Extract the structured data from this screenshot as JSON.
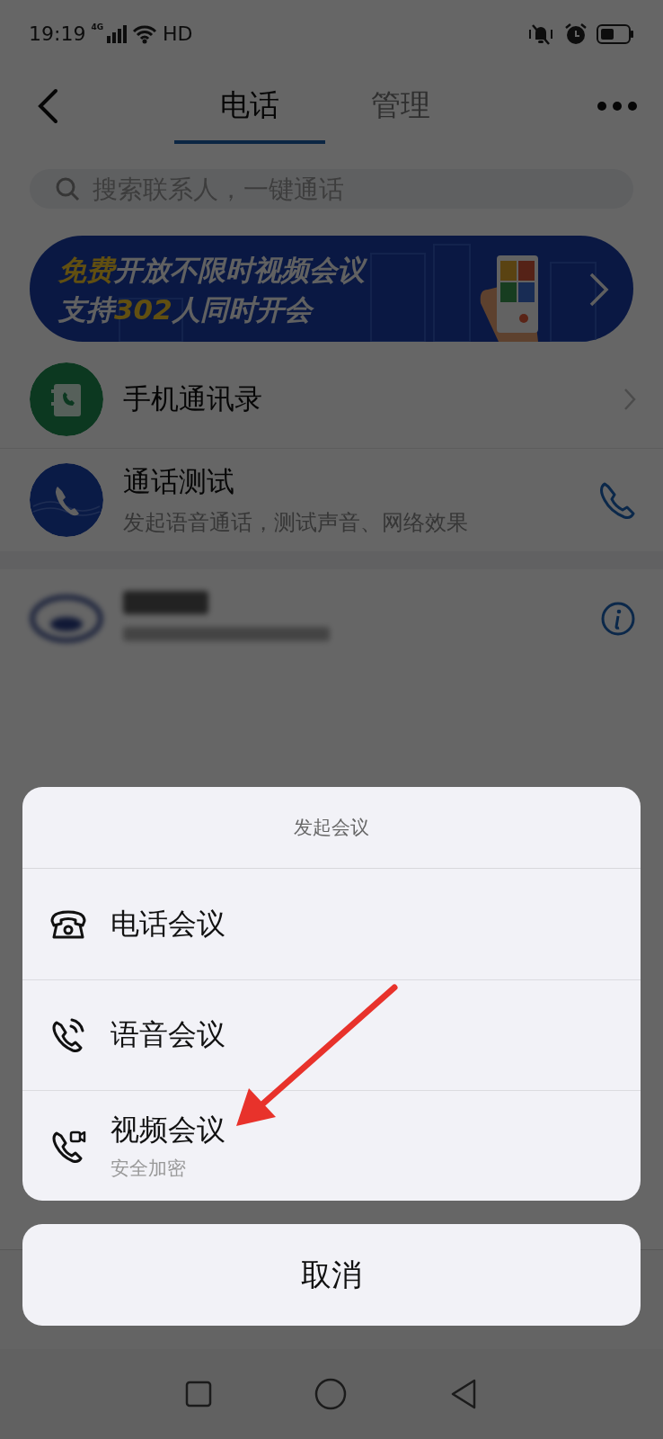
{
  "status_bar": {
    "time": "19:19",
    "network": "4G",
    "hd": "HD"
  },
  "header": {
    "tabs": [
      {
        "label": "电话",
        "selected": true
      },
      {
        "label": "管理",
        "selected": false
      }
    ]
  },
  "search": {
    "placeholder": "搜索联系人，一键通话"
  },
  "banner": {
    "lines": [
      [
        {
          "text": "免费",
          "highlight": true
        },
        {
          "text": "开放不限时视频会议",
          "highlight": false
        }
      ],
      [
        {
          "text": "支持",
          "highlight": false
        },
        {
          "text": "302",
          "highlight": true
        },
        {
          "text": "人同时开会",
          "highlight": false
        }
      ]
    ]
  },
  "entries": [
    {
      "kind": "contacts",
      "title": "手机通讯录"
    },
    {
      "kind": "call_test",
      "title": "通话测试",
      "subtitle": "发起语音通话，测试声音、网络效果"
    },
    {
      "kind": "blurred"
    }
  ],
  "sheet": {
    "title": "发起会议",
    "options": [
      {
        "kind": "phone",
        "label": "电话会议"
      },
      {
        "kind": "voice",
        "label": "语音会议"
      },
      {
        "kind": "video",
        "label": "视频会议",
        "subtitle": "安全加密"
      }
    ],
    "cancel": "取消"
  }
}
